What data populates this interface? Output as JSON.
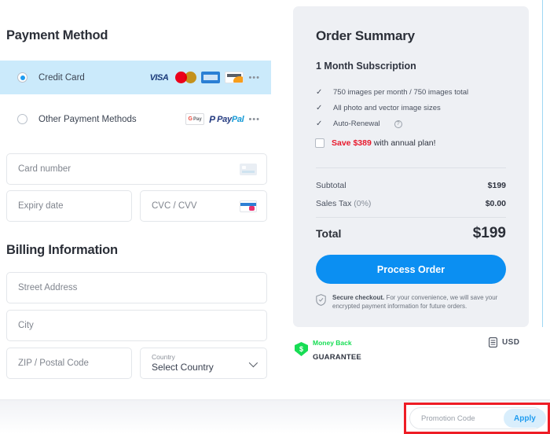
{
  "payment": {
    "section_title": "Payment Method",
    "options": [
      {
        "label": "Credit Card",
        "selected": true,
        "brands": [
          "visa-icon",
          "mastercard-icon",
          "amex-icon",
          "discover-icon",
          "more-dots-icon"
        ]
      },
      {
        "label": "Other Payment Methods",
        "selected": false,
        "brands": [
          "google-pay-icon",
          "paypal-icon",
          "more-dots-icon"
        ]
      }
    ],
    "brand_labels": {
      "visa": "VISA",
      "paypal_pay": "Pay",
      "paypal_pal": "Pal",
      "gpay_g": "G",
      "gpay_pay": "Pay",
      "dots": "•••"
    },
    "fields": {
      "card_number": "Card number",
      "expiry": "Expiry date",
      "cvc": "CVC / CVV"
    }
  },
  "billing": {
    "section_title": "Billing Information",
    "fields": {
      "street": "Street Address",
      "city": "City",
      "zip": "ZIP / Postal Code",
      "country_label": "Country",
      "country_value": "Select Country"
    }
  },
  "summary": {
    "title": "Order Summary",
    "plan": "1 Month Subscription",
    "features": [
      "750 images per month / 750 images total",
      "All photo and vector image sizes",
      "Auto-Renewal"
    ],
    "auto_renewal_help": "?",
    "check_glyph": "✓",
    "upsell": {
      "highlight": "Save $389",
      "rest": " with annual plan!",
      "checked": false
    },
    "lines": [
      {
        "label": "Subtotal",
        "suffix": "",
        "value": "$199"
      },
      {
        "label": "Sales Tax ",
        "suffix": "(0%)",
        "value": "$0.00"
      }
    ],
    "total_label": "Total",
    "total_value": "$199",
    "cta_label": "Process Order",
    "secure_bold": "Secure checkout.",
    "secure_rest": " For your convenience, we will save your encrypted payment information for future orders."
  },
  "guarantee": {
    "badge_glyph": "$",
    "line1": "Money Back",
    "line2": "GUARANTEE"
  },
  "currency": {
    "code": "USD"
  },
  "promotion": {
    "placeholder": "Promotion Code",
    "value": "",
    "apply_label": "Apply"
  },
  "colors": {
    "accent_blue": "#0b8ff2",
    "selected_row": "#cbeafb",
    "summary_bg": "#eef0f4",
    "save_red": "#e8192c",
    "highlight_red": "#ee1c25",
    "guarantee_green": "#17dd54"
  }
}
